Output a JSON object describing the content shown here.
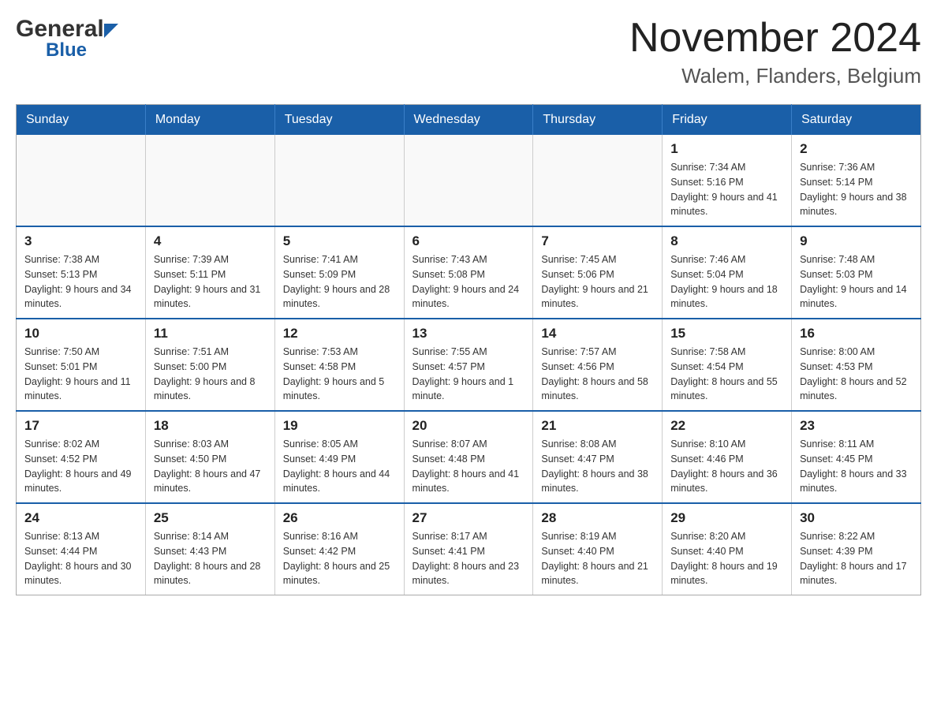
{
  "header": {
    "logo_general": "General",
    "logo_blue": "Blue",
    "month_title": "November 2024",
    "location": "Walem, Flanders, Belgium"
  },
  "weekdays": [
    "Sunday",
    "Monday",
    "Tuesday",
    "Wednesday",
    "Thursday",
    "Friday",
    "Saturday"
  ],
  "weeks": [
    {
      "days": [
        {
          "num": "",
          "info": ""
        },
        {
          "num": "",
          "info": ""
        },
        {
          "num": "",
          "info": ""
        },
        {
          "num": "",
          "info": ""
        },
        {
          "num": "",
          "info": ""
        },
        {
          "num": "1",
          "info": "Sunrise: 7:34 AM\nSunset: 5:16 PM\nDaylight: 9 hours and 41 minutes."
        },
        {
          "num": "2",
          "info": "Sunrise: 7:36 AM\nSunset: 5:14 PM\nDaylight: 9 hours and 38 minutes."
        }
      ]
    },
    {
      "days": [
        {
          "num": "3",
          "info": "Sunrise: 7:38 AM\nSunset: 5:13 PM\nDaylight: 9 hours and 34 minutes."
        },
        {
          "num": "4",
          "info": "Sunrise: 7:39 AM\nSunset: 5:11 PM\nDaylight: 9 hours and 31 minutes."
        },
        {
          "num": "5",
          "info": "Sunrise: 7:41 AM\nSunset: 5:09 PM\nDaylight: 9 hours and 28 minutes."
        },
        {
          "num": "6",
          "info": "Sunrise: 7:43 AM\nSunset: 5:08 PM\nDaylight: 9 hours and 24 minutes."
        },
        {
          "num": "7",
          "info": "Sunrise: 7:45 AM\nSunset: 5:06 PM\nDaylight: 9 hours and 21 minutes."
        },
        {
          "num": "8",
          "info": "Sunrise: 7:46 AM\nSunset: 5:04 PM\nDaylight: 9 hours and 18 minutes."
        },
        {
          "num": "9",
          "info": "Sunrise: 7:48 AM\nSunset: 5:03 PM\nDaylight: 9 hours and 14 minutes."
        }
      ]
    },
    {
      "days": [
        {
          "num": "10",
          "info": "Sunrise: 7:50 AM\nSunset: 5:01 PM\nDaylight: 9 hours and 11 minutes."
        },
        {
          "num": "11",
          "info": "Sunrise: 7:51 AM\nSunset: 5:00 PM\nDaylight: 9 hours and 8 minutes."
        },
        {
          "num": "12",
          "info": "Sunrise: 7:53 AM\nSunset: 4:58 PM\nDaylight: 9 hours and 5 minutes."
        },
        {
          "num": "13",
          "info": "Sunrise: 7:55 AM\nSunset: 4:57 PM\nDaylight: 9 hours and 1 minute."
        },
        {
          "num": "14",
          "info": "Sunrise: 7:57 AM\nSunset: 4:56 PM\nDaylight: 8 hours and 58 minutes."
        },
        {
          "num": "15",
          "info": "Sunrise: 7:58 AM\nSunset: 4:54 PM\nDaylight: 8 hours and 55 minutes."
        },
        {
          "num": "16",
          "info": "Sunrise: 8:00 AM\nSunset: 4:53 PM\nDaylight: 8 hours and 52 minutes."
        }
      ]
    },
    {
      "days": [
        {
          "num": "17",
          "info": "Sunrise: 8:02 AM\nSunset: 4:52 PM\nDaylight: 8 hours and 49 minutes."
        },
        {
          "num": "18",
          "info": "Sunrise: 8:03 AM\nSunset: 4:50 PM\nDaylight: 8 hours and 47 minutes."
        },
        {
          "num": "19",
          "info": "Sunrise: 8:05 AM\nSunset: 4:49 PM\nDaylight: 8 hours and 44 minutes."
        },
        {
          "num": "20",
          "info": "Sunrise: 8:07 AM\nSunset: 4:48 PM\nDaylight: 8 hours and 41 minutes."
        },
        {
          "num": "21",
          "info": "Sunrise: 8:08 AM\nSunset: 4:47 PM\nDaylight: 8 hours and 38 minutes."
        },
        {
          "num": "22",
          "info": "Sunrise: 8:10 AM\nSunset: 4:46 PM\nDaylight: 8 hours and 36 minutes."
        },
        {
          "num": "23",
          "info": "Sunrise: 8:11 AM\nSunset: 4:45 PM\nDaylight: 8 hours and 33 minutes."
        }
      ]
    },
    {
      "days": [
        {
          "num": "24",
          "info": "Sunrise: 8:13 AM\nSunset: 4:44 PM\nDaylight: 8 hours and 30 minutes."
        },
        {
          "num": "25",
          "info": "Sunrise: 8:14 AM\nSunset: 4:43 PM\nDaylight: 8 hours and 28 minutes."
        },
        {
          "num": "26",
          "info": "Sunrise: 8:16 AM\nSunset: 4:42 PM\nDaylight: 8 hours and 25 minutes."
        },
        {
          "num": "27",
          "info": "Sunrise: 8:17 AM\nSunset: 4:41 PM\nDaylight: 8 hours and 23 minutes."
        },
        {
          "num": "28",
          "info": "Sunrise: 8:19 AM\nSunset: 4:40 PM\nDaylight: 8 hours and 21 minutes."
        },
        {
          "num": "29",
          "info": "Sunrise: 8:20 AM\nSunset: 4:40 PM\nDaylight: 8 hours and 19 minutes."
        },
        {
          "num": "30",
          "info": "Sunrise: 8:22 AM\nSunset: 4:39 PM\nDaylight: 8 hours and 17 minutes."
        }
      ]
    }
  ]
}
